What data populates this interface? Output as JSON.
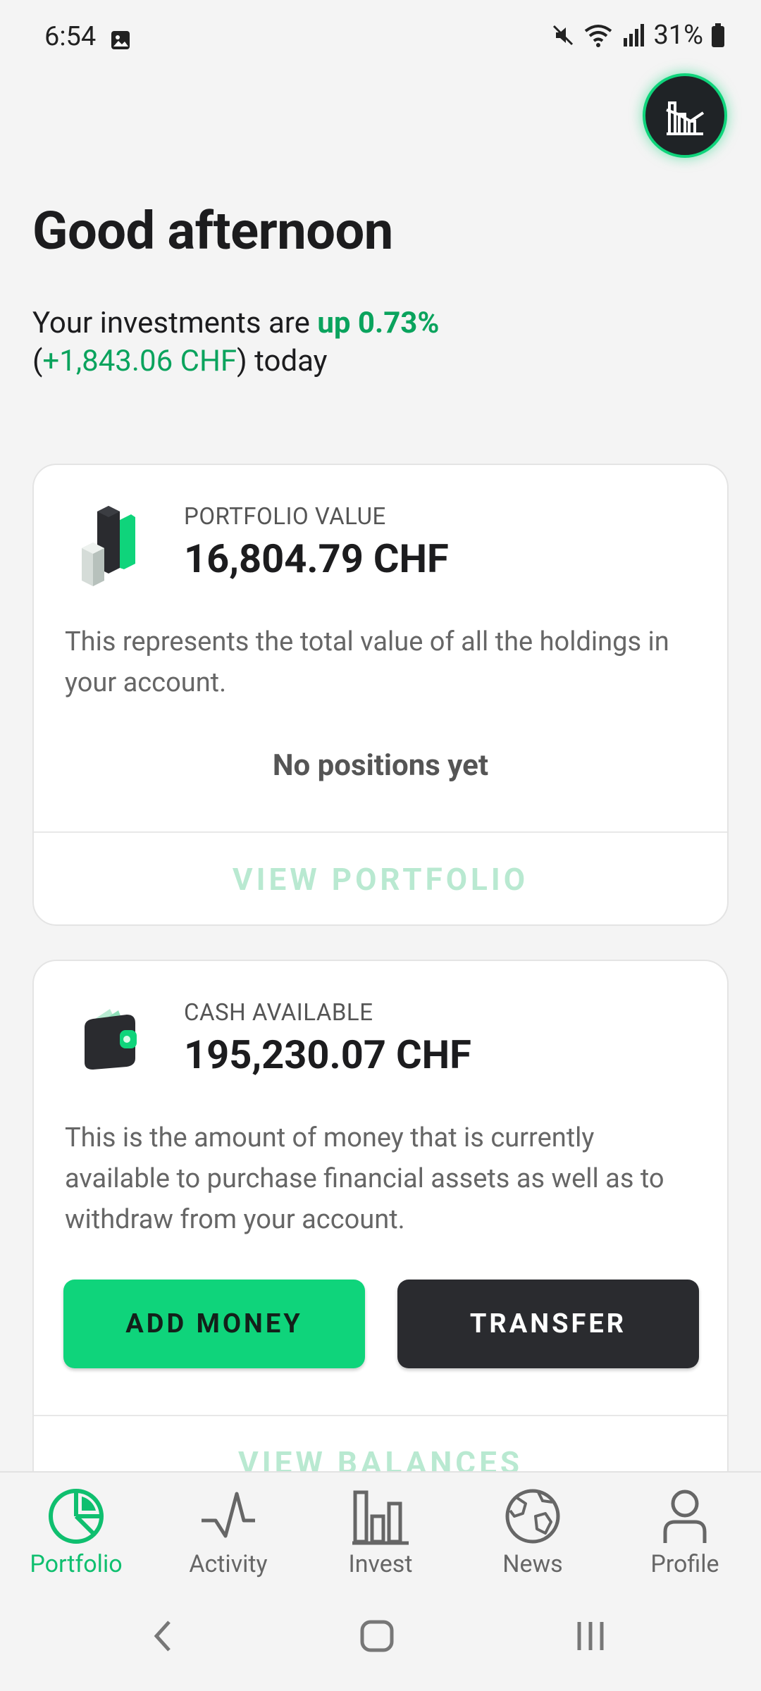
{
  "status_bar": {
    "time": "6:54",
    "battery": "31%"
  },
  "greeting": "Good afternoon",
  "summary": {
    "prefix": "Your investments are ",
    "change_pct": "up 0.73%",
    "open_paren": "(",
    "change_amount": "+1,843.06 CHF",
    "suffix": ") today"
  },
  "portfolio_card": {
    "label": "PORTFOLIO VALUE",
    "value": "16,804.79 CHF",
    "description": "This represents the total value of all the holdings in your account.",
    "empty_state": "No positions yet",
    "link": "VIEW PORTFOLIO"
  },
  "cash_card": {
    "label": "CASH AVAILABLE",
    "value": "195,230.07 CHF",
    "description": "This is the amount of money that is currently available to purchase financial assets as well as to withdraw from your account.",
    "add_button": "ADD MONEY",
    "transfer_button": "TRANSFER",
    "link": "VIEW BALANCES"
  },
  "bottom_nav": {
    "items": [
      {
        "label": "Portfolio",
        "icon": "pie-chart-icon",
        "active": true
      },
      {
        "label": "Activity",
        "icon": "pulse-icon",
        "active": false
      },
      {
        "label": "Invest",
        "icon": "bar-chart-icon",
        "active": false
      },
      {
        "label": "News",
        "icon": "globe-icon",
        "active": false
      },
      {
        "label": "Profile",
        "icon": "person-icon",
        "active": false
      }
    ]
  },
  "colors": {
    "accent": "#0fd47b",
    "dark": "#2a2b2f",
    "positive": "#0aa35d"
  }
}
